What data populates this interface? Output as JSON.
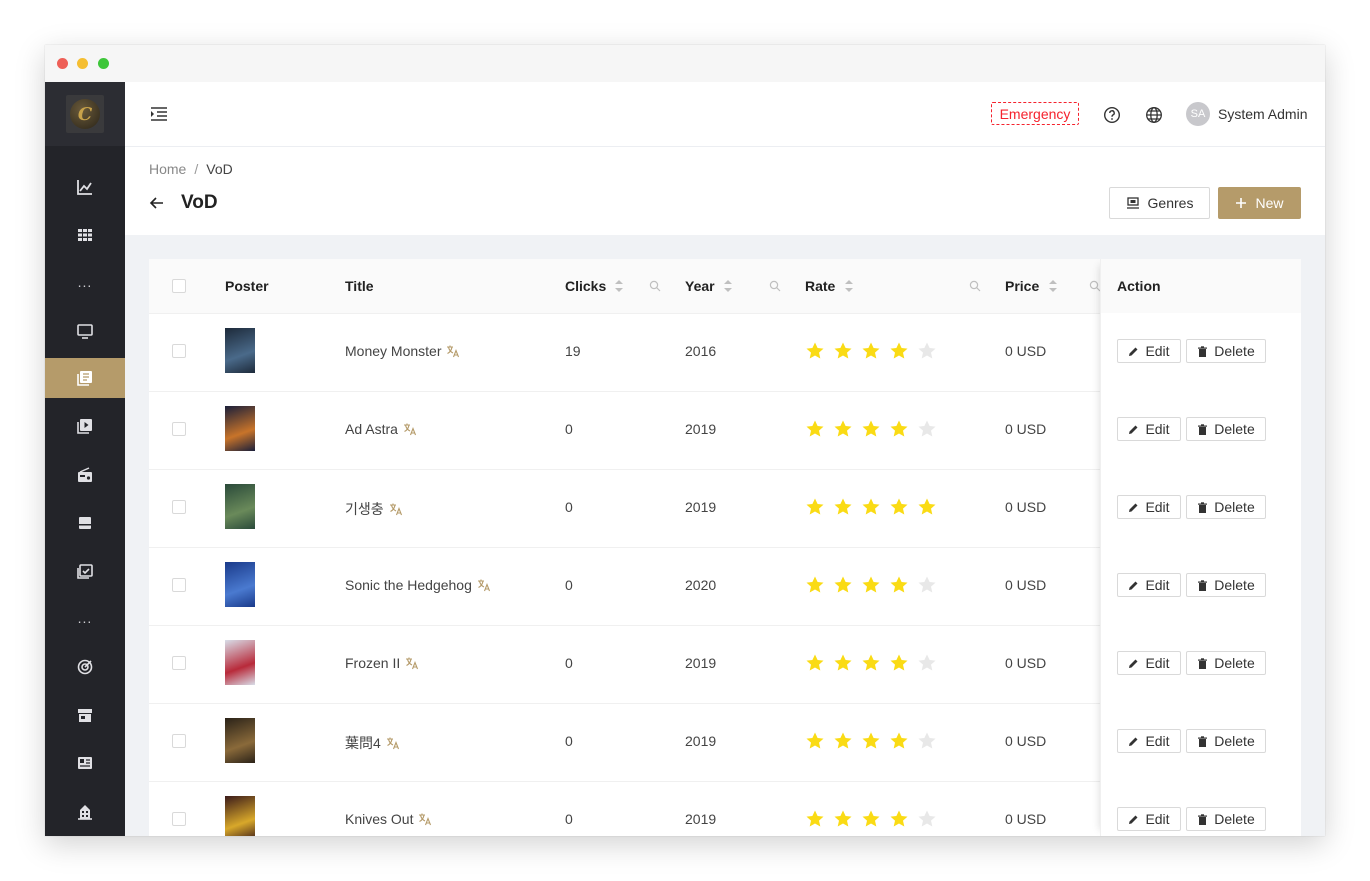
{
  "header": {
    "emergency_label": "Emergency",
    "user_initials": "SA",
    "user_name": "System Admin"
  },
  "breadcrumb": {
    "home": "Home",
    "separator": "/",
    "current": "VoD"
  },
  "page": {
    "title": "VoD",
    "genres_label": "Genres",
    "new_label": "New"
  },
  "sidebar": {
    "items": [
      "chart-icon",
      "grid-icon",
      "more-dots",
      "monitor-icon",
      "library-icon",
      "play-icon",
      "radio-icon",
      "archive-icon",
      "calendar-check-icon",
      "more-dots",
      "target-icon",
      "store-icon",
      "news-icon",
      "building-icon"
    ],
    "active_index": 4,
    "dots": "..."
  },
  "table": {
    "columns": {
      "poster": "Poster",
      "title": "Title",
      "clicks": "Clicks",
      "year": "Year",
      "rate": "Rate",
      "price": "Price",
      "action": "Action"
    },
    "edit_label": "Edit",
    "delete_label": "Delete",
    "rows": [
      {
        "title": "Money Monster",
        "clicks": "19",
        "year": "2016",
        "rating": 4,
        "price": "0 USD",
        "poster_colors": [
          "#1d2a3a",
          "#4a6a8a"
        ]
      },
      {
        "title": "Ad Astra",
        "clicks": "0",
        "year": "2019",
        "rating": 4,
        "price": "0 USD",
        "poster_colors": [
          "#1a1f3a",
          "#c8742a"
        ]
      },
      {
        "title": "기생충",
        "clicks": "0",
        "year": "2019",
        "rating": 5,
        "price": "0 USD",
        "poster_colors": [
          "#2a4a3a",
          "#6a8a5a"
        ]
      },
      {
        "title": "Sonic the Hedgehog",
        "clicks": "0",
        "year": "2020",
        "rating": 4,
        "price": "0 USD",
        "poster_colors": [
          "#1a3a8a",
          "#4a7ad0"
        ]
      },
      {
        "title": "Frozen II",
        "clicks": "0",
        "year": "2019",
        "rating": 4,
        "price": "0 USD",
        "poster_colors": [
          "#d8dde8",
          "#b82a3a"
        ]
      },
      {
        "title": "葉問4",
        "clicks": "0",
        "year": "2019",
        "rating": 4,
        "price": "0 USD",
        "poster_colors": [
          "#2a2218",
          "#8a6a3a"
        ]
      },
      {
        "title": "Knives Out",
        "clicks": "0",
        "year": "2019",
        "rating": 4,
        "price": "0 USD",
        "poster_colors": [
          "#3a1a1a",
          "#d8a82a"
        ]
      }
    ]
  },
  "colors": {
    "accent": "#b59b6a",
    "sidebar_bg": "#232429",
    "star_on": "#fadb14",
    "star_off": "#e8e8e8",
    "emergency": "#f5222d"
  }
}
